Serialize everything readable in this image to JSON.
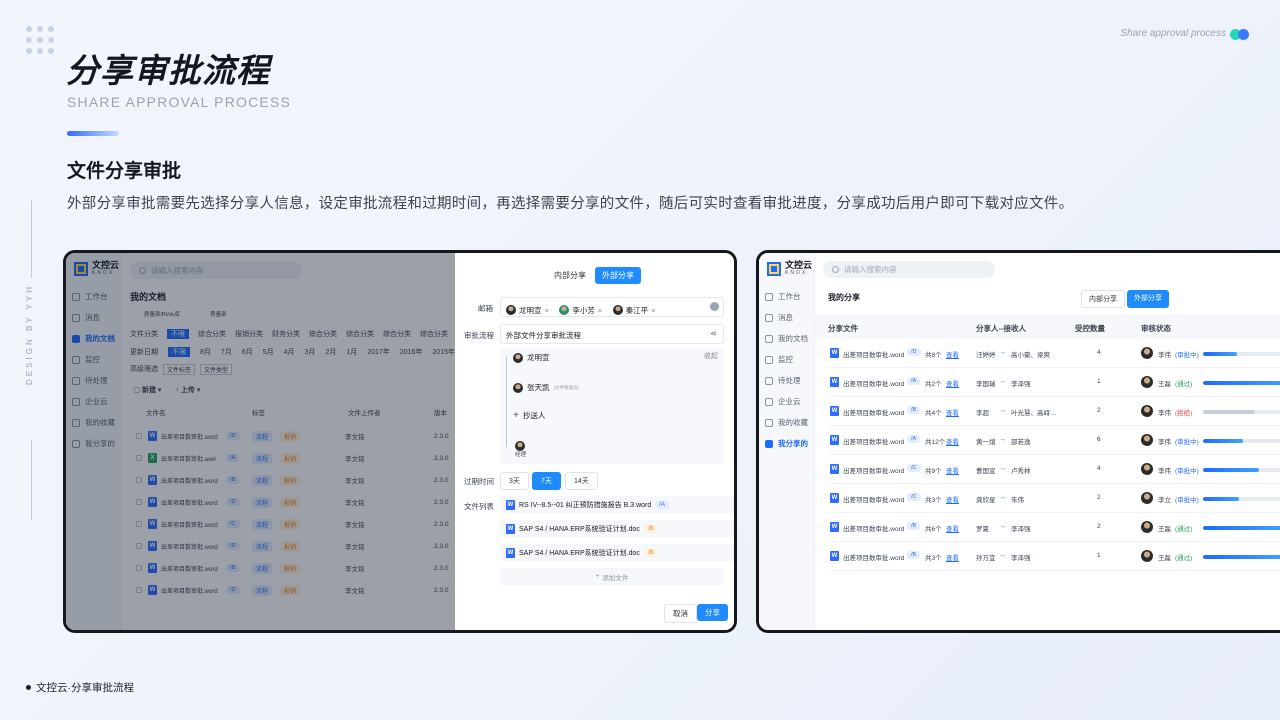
{
  "hero": {
    "title": "分享审批流程",
    "subtitle": "SHARE APPROVAL PROCESS",
    "top_right": "Share approval process",
    "vertical": "DESIGN BY YYH"
  },
  "section": {
    "title": "文件分享审批",
    "desc": "外部分享审批需要先选择分享人信息，设定审批流程和过期时间，再选择需要分享的文件，随后可实时查看审批进度，分享成功后用户即可下载对应文件。"
  },
  "footer": "文控云·分享审批流程",
  "colors": {
    "accent": "#1f8bff",
    "brand_blue": "#1f6bff",
    "warn": "#f08a1c",
    "ok": "#22a45d",
    "danger": "#f0483e"
  },
  "app": {
    "logo": {
      "name": "文控云",
      "en": "KNOX"
    },
    "search_placeholder": "请输入搜索内容",
    "nav": [
      "工作台",
      "消息",
      "我的文档",
      "监控",
      "待处理",
      "企业云",
      "我的收藏",
      "我分享的"
    ]
  },
  "screen1": {
    "page_title": "我的文档",
    "crumbs": [
      "质量部/BI/dv库",
      "质量部"
    ],
    "filter_labels": [
      "文件分类",
      "更新日期",
      "高级筛选"
    ],
    "file_types": [
      "不限",
      "综合分类",
      "报销分类",
      "财务分类",
      "综合分类",
      "综合分类",
      "综合分类",
      "综合分类"
    ],
    "dates": [
      "不限",
      "8月",
      "7月",
      "6月",
      "5月",
      "4月",
      "3月",
      "2月",
      "1月",
      "2017年",
      "2016年",
      "2015年"
    ],
    "adv": [
      "文件标签",
      "文件类型"
    ],
    "toolbar": {
      "new": "新建",
      "upload": "上传"
    },
    "columns": [
      "文件名",
      "标签",
      "文件上传者",
      "版本"
    ],
    "rows": [
      {
        "name": "出差项目数审批.word",
        "tag": "/D",
        "t1": "流程",
        "t2": "报销",
        "owner": "李文铭",
        "ver": "2.3.0",
        "type": "W"
      },
      {
        "name": "出差项目数审批.axel",
        "tag": "/A",
        "t1": "流程",
        "t2": "报销",
        "owner": "李文铭",
        "ver": "2.3.0",
        "type": "X"
      },
      {
        "name": "出差项目数审批.word",
        "tag": "/B",
        "t1": "流程",
        "t2": "报销",
        "owner": "李文铭",
        "ver": "2.3.0",
        "type": "W"
      },
      {
        "name": "出差项目数审批.word",
        "tag": "/D",
        "t1": "流程",
        "t2": "报销",
        "owner": "李文铭",
        "ver": "2.3.0",
        "type": "W"
      },
      {
        "name": "出差项目数审批.word",
        "tag": "/C",
        "t1": "流程",
        "t2": "报销",
        "owner": "李文铭",
        "ver": "2.3.0",
        "type": "W"
      },
      {
        "name": "出差项目数审批.word",
        "tag": "/D",
        "t1": "流程",
        "t2": "报销",
        "owner": "李文铭",
        "ver": "2.3.0",
        "type": "W"
      },
      {
        "name": "出差项目数审批.word",
        "tag": "/B",
        "t1": "流程",
        "t2": "报销",
        "owner": "李文铭",
        "ver": "2.3.0",
        "type": "W"
      },
      {
        "name": "出差项目数审批.word",
        "tag": "/D",
        "t1": "流程",
        "t2": "报销",
        "owner": "李文铭",
        "ver": "2.3.0",
        "type": "W"
      }
    ],
    "share_panel": {
      "tabs": [
        "内部分享",
        "外部分享"
      ],
      "email_label": "邮箱",
      "recipients": [
        "龙明宣",
        "李小芳",
        "秦江平"
      ],
      "flow_label": "审批流程",
      "flow_value": "外部文件分享审批流程",
      "collapse": "收起",
      "steps": [
        {
          "name": "龙明宣",
          "note": ""
        },
        {
          "name": "张天凯",
          "note": "(文件管理员)"
        },
        {
          "name": "抄送人",
          "note": ""
        },
        {
          "name": "经理",
          "note": ""
        }
      ],
      "expire_label": "过期时间",
      "expire_options": [
        "3天",
        "7天",
        "14天"
      ],
      "files_label": "文件列表",
      "files": [
        {
          "name": "RS IV--8.5--01 纠正预防措施报告 B.3.word",
          "tag": "/A"
        },
        {
          "name": "SAP S4 / HANA ERP系统验证计划.doc",
          "tag": "/B"
        },
        {
          "name": "SAP S4 / HANA ERP系统验证计划.doc",
          "tag": "/B"
        }
      ],
      "add_file": "添加文件",
      "cancel": "取消",
      "share": "分享"
    }
  },
  "screen2": {
    "page_title": "我的分享",
    "tabs": [
      "内部分享",
      "外部分享"
    ],
    "columns": [
      "分享文件",
      "分享人--接收人",
      "受控数量",
      "审核状态"
    ],
    "rows": [
      {
        "file": "出差项目数审批.word",
        "tag": "/D",
        "count": "共8个",
        "view": "查看",
        "from": "汪婷婷",
        "to": "高小豪、梁爽",
        "qty": "4",
        "approver": "李伟",
        "status": "(审批中)",
        "progress": 0.42,
        "scolor": "#1f6bff"
      },
      {
        "file": "出差项目数审批.word",
        "tag": "/A",
        "count": "共2个",
        "view": "查看",
        "from": "李国瑞",
        "to": "李泽强",
        "qty": "1",
        "approver": "王磊",
        "status": "(通过)",
        "progress": 1.0,
        "scolor": "#22a45d"
      },
      {
        "file": "出差项目数审批.word",
        "tag": "/B",
        "count": "共4个",
        "view": "查看",
        "from": "李超",
        "to": "叶光慧、高峙…",
        "qty": "2",
        "approver": "李伟",
        "status": "(拒绝)",
        "progress": 0.65,
        "scolor": "#f0483e"
      },
      {
        "file": "出差项目数审批.word",
        "tag": "/A",
        "count": "共12个",
        "view": "查看",
        "from": "黄一煊",
        "to": "邵若逸",
        "qty": "6",
        "approver": "李伟",
        "status": "(审批中)",
        "progress": 0.5,
        "scolor": "#1f6bff"
      },
      {
        "file": "出差项目数审批.word",
        "tag": "/C",
        "count": "共9个",
        "view": "查看",
        "from": "曹国宣",
        "to": "卢秀林",
        "qty": "4",
        "approver": "李伟",
        "status": "(审批中)",
        "progress": 0.7,
        "scolor": "#1f6bff"
      },
      {
        "file": "出差项目数审批.word",
        "tag": "/C",
        "count": "共3个",
        "view": "查看",
        "from": "龚欣星",
        "to": "朱伟",
        "qty": "2",
        "approver": "李立",
        "status": "(审批中)",
        "progress": 0.45,
        "scolor": "#1f6bff"
      },
      {
        "file": "出差项目数审批.word",
        "tag": "/B",
        "count": "共6个",
        "view": "查看",
        "from": "罗夏",
        "to": "李泽强",
        "qty": "2",
        "approver": "王磊",
        "status": "(通过)",
        "progress": 1.0,
        "scolor": "#22a45d"
      },
      {
        "file": "出差项目数审批.word",
        "tag": "/B",
        "count": "共3个",
        "view": "查看",
        "from": "孙万宜",
        "to": "李泽强",
        "qty": "1",
        "approver": "王磊",
        "status": "(通过)",
        "progress": 1.0,
        "scolor": "#22a45d"
      }
    ]
  }
}
